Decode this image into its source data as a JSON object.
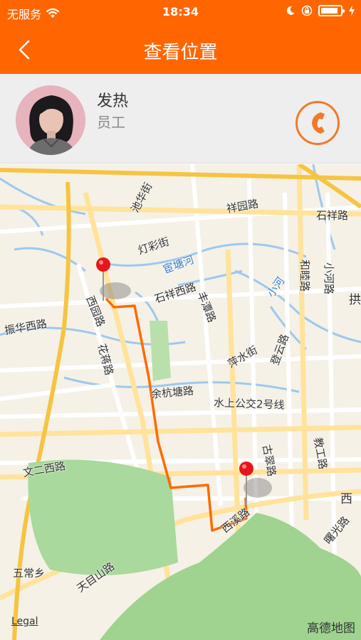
{
  "status_bar": {
    "carrier": "无服务",
    "time": "18:34",
    "battery_level": 0.9
  },
  "nav": {
    "title": "查看位置"
  },
  "profile": {
    "name": "发热",
    "role": "员工"
  },
  "map": {
    "labels": {
      "chihua": "池华街",
      "xiangyuan": "祥园路",
      "shixiang_e": "石祥路",
      "dengcai": "灯彩街",
      "didang": "宦塘河",
      "xiaohe_road": "小河路",
      "hezhu": "和睦路",
      "xiaohe_river": "小河",
      "shixiang_w": "石祥西路",
      "fengtan": "丰潭路",
      "xiyuan": "西园路",
      "zhenhua": "振华西路",
      "huajiang": "花蒋路",
      "pingshui": "萍水街",
      "dengyun": "登云路",
      "yuhang": "余杭塘路",
      "bus_line": "水上公交2号线",
      "gucui": "古翠路",
      "jiaogong": "教工路",
      "wener": "文二西路",
      "xixi": "西溪路",
      "xi_char": "西",
      "shuguang": "曙光路",
      "tianmu": "天目山路",
      "wuchang": "五常乡",
      "edge_char": "拱"
    },
    "legal": "Legal",
    "brand": "高德地图"
  }
}
